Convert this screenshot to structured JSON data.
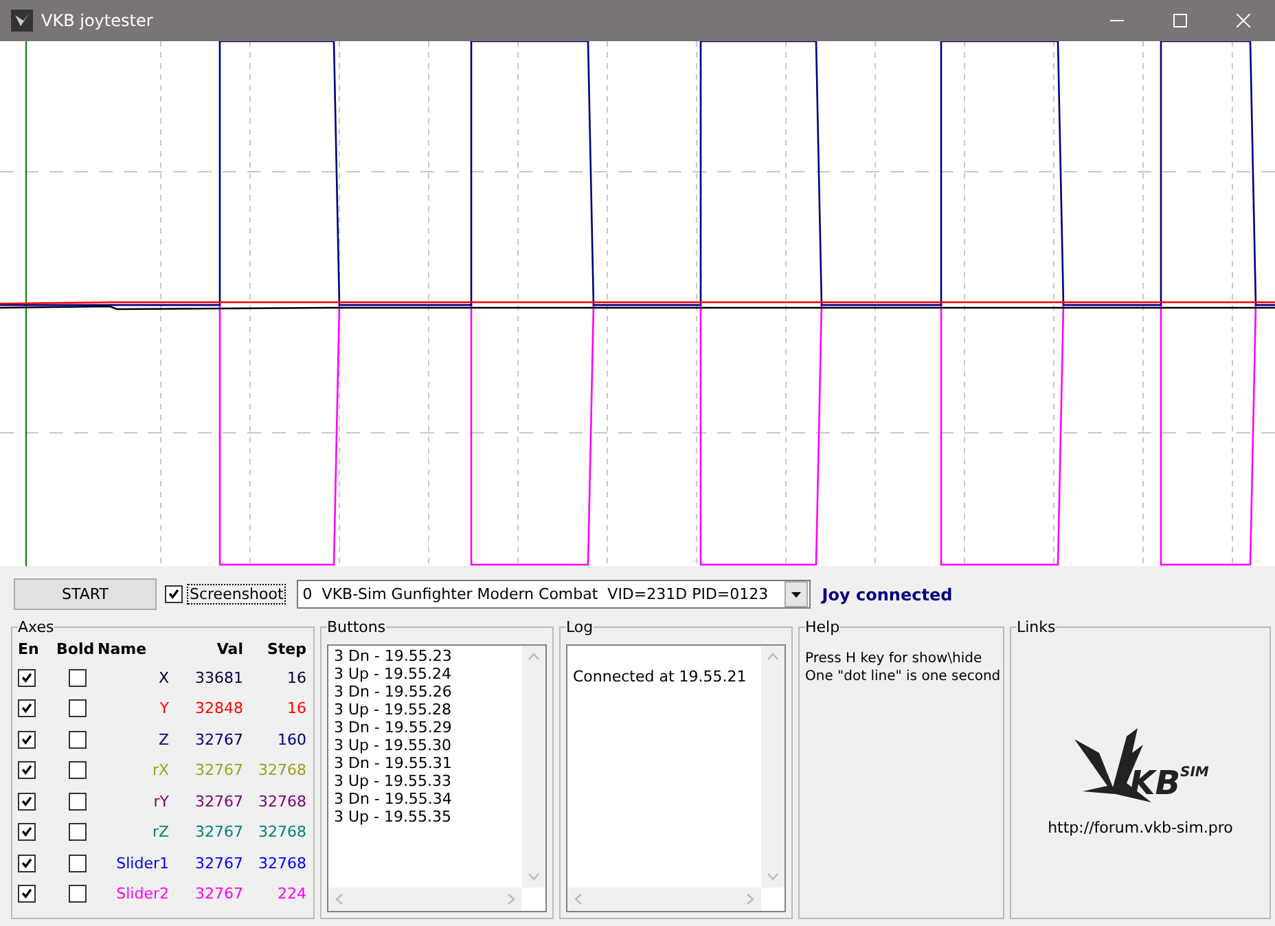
{
  "window": {
    "title": "VKB joytester"
  },
  "toolbar": {
    "start_button": "START",
    "screenshot": {
      "label": "Screenshoot",
      "checked": true
    },
    "device": "0  VKB-Sim Gunfighter Modern Combat  VID=231D PID=0123",
    "status": "Joy connected"
  },
  "axes": {
    "title": "Axes",
    "columns": [
      "En",
      "Bold",
      "Name",
      "Val",
      "Step"
    ],
    "rows": [
      {
        "en": true,
        "bold": false,
        "name": "X",
        "val": "33681",
        "step": "16",
        "color": "#000040"
      },
      {
        "en": true,
        "bold": false,
        "name": "Y",
        "val": "32848",
        "step": "16",
        "color": "#ff0000"
      },
      {
        "en": true,
        "bold": false,
        "name": "Z",
        "val": "32767",
        "step": "160",
        "color": "#000080"
      },
      {
        "en": true,
        "bold": false,
        "name": "rX",
        "val": "32767",
        "step": "32768",
        "color": "#a0a020"
      },
      {
        "en": true,
        "bold": false,
        "name": "rY",
        "val": "32767",
        "step": "32768",
        "color": "#800080"
      },
      {
        "en": true,
        "bold": false,
        "name": "rZ",
        "val": "32767",
        "step": "32768",
        "color": "#008080"
      },
      {
        "en": true,
        "bold": false,
        "name": "Slider1",
        "val": "32767",
        "step": "32768",
        "color": "#0000ff"
      },
      {
        "en": true,
        "bold": false,
        "name": "Slider2",
        "val": "32767",
        "step": "224",
        "color": "#ff00ff"
      }
    ]
  },
  "buttons": {
    "title": "Buttons",
    "entries": [
      "3 Dn - 19.55.23",
      "3 Up - 19.55.24",
      "3 Dn - 19.55.26",
      "3 Up - 19.55.28",
      "3 Dn - 19.55.29",
      "3 Up - 19.55.30",
      "3 Dn - 19.55.31",
      "3 Up - 19.55.33",
      "3 Dn - 19.55.34",
      "3 Up - 19.55.35"
    ]
  },
  "log": {
    "title": "Log",
    "entries": [
      "Connected at 19.55.21"
    ]
  },
  "help": {
    "title": "Help",
    "lines": [
      "Press H key for show\\hide",
      "One \"dot line\" is one second"
    ]
  },
  "links": {
    "title": "Links",
    "logo_text": "KB",
    "logo_sup": "SIM",
    "url": "http://forum.vkb-sim.pro"
  }
}
